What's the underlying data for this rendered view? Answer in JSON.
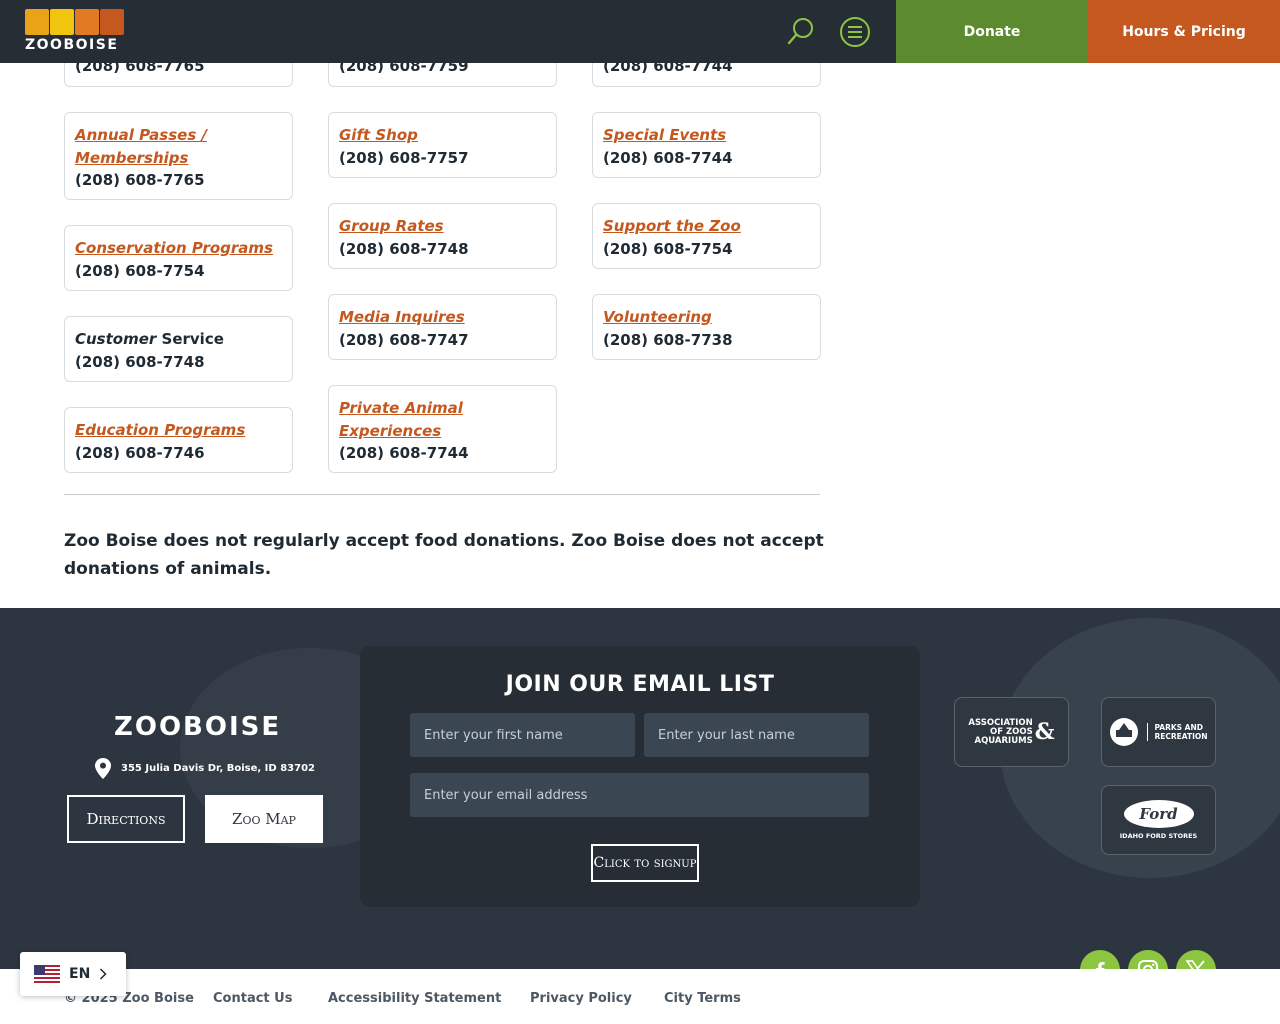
{
  "header": {
    "logo_text": "ZOOBOISE",
    "donate_label": "Donate",
    "hours_label": "Hours & Pricing"
  },
  "contacts": {
    "col1": [
      {
        "phone": "(208) 608-7765"
      },
      {
        "title": "Annual Passes /",
        "title2": "Memberships",
        "phone": "(208) 608-7765"
      },
      {
        "title": "Conservation Programs",
        "phone": "(208) 608-7754"
      },
      {
        "title_italic": "Customer",
        "title_rest": " Service",
        "phone": "(208) 608-7748"
      },
      {
        "title": "Education Programs",
        "phone": "(208) 608-7746"
      }
    ],
    "col2": [
      {
        "phone": "(208) 608-7759"
      },
      {
        "title": "Gift Shop",
        "phone": "(208) 608-7757"
      },
      {
        "title": "Group Rates",
        "phone": "(208) 608-7748"
      },
      {
        "title": "Media Inquires",
        "phone": "(208) 608-7747"
      },
      {
        "title": "Private Animal",
        "title2": "Experiences",
        "phone": "(208) 608-7744"
      }
    ],
    "col3": [
      {
        "phone": "(208) 608-7744"
      },
      {
        "title": "Special Events",
        "phone": "(208) 608-7744"
      },
      {
        "title": "Support the Zoo",
        "phone": "(208) 608-7754"
      },
      {
        "title": "Volunteering",
        "phone": "(208) 608-7738"
      }
    ]
  },
  "note": "Zoo Boise does not regularly accept food donations. Zoo Boise does not accept donations of animals.",
  "footer": {
    "logo_text": "ZOOBOISE",
    "address": "355 Julia Davis Dr, Boise, ID 83702",
    "directions_label": "Directions",
    "map_label": "Zoo Map",
    "email_title": "JOIN OUR EMAIL LIST",
    "first_name_placeholder": "Enter your first name",
    "last_name_placeholder": "Enter your last name",
    "email_placeholder": "Enter your email address",
    "signup_label": "Click to signup",
    "partners": {
      "aza_line1": "ASSOCIATION",
      "aza_line2": "OF ZOOS",
      "aza_line3": "AQUARIUMS",
      "parks_line1": "PARKS AND",
      "parks_line2": "RECREATION",
      "ford_text": "Ford",
      "ford_sub": "IDAHO FORD STORES"
    }
  },
  "bottom": {
    "copyright": "© 2025 Zoo Boise",
    "links": [
      "Contact Us",
      "Accessibility Statement",
      "Privacy Policy",
      "City Terms"
    ]
  },
  "language": "EN",
  "colors": {
    "header_bg": "#262d34",
    "donate": "#5c8a2e",
    "hours": "#c4581e",
    "link_orange": "#c4581e",
    "footer_bg": "#2d3640",
    "social_green": "#8cc641",
    "icon_green": "#8cc641"
  }
}
